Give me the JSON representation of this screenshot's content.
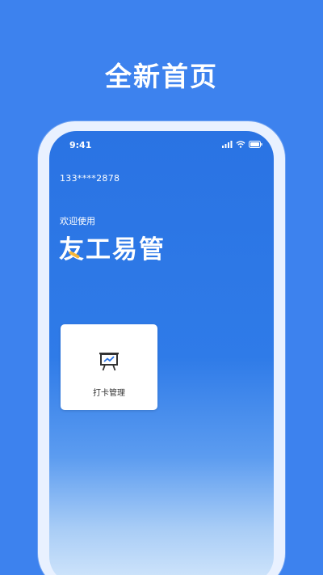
{
  "headline": "全新首页",
  "status": {
    "time": "9:41",
    "icons": [
      "signal-icon",
      "wifi-icon",
      "battery-icon"
    ]
  },
  "account": {
    "phone": "133****2878"
  },
  "welcome": {
    "subtitle": "欢迎使用",
    "brand": "友工易管"
  },
  "cards": [
    {
      "label": "打卡管理",
      "icon": "presentation-chart-icon"
    }
  ],
  "colors": {
    "background": "#3d82ee",
    "screen_top": "#2a73e3",
    "accent": "#f5b73a",
    "card": "#ffffff"
  }
}
